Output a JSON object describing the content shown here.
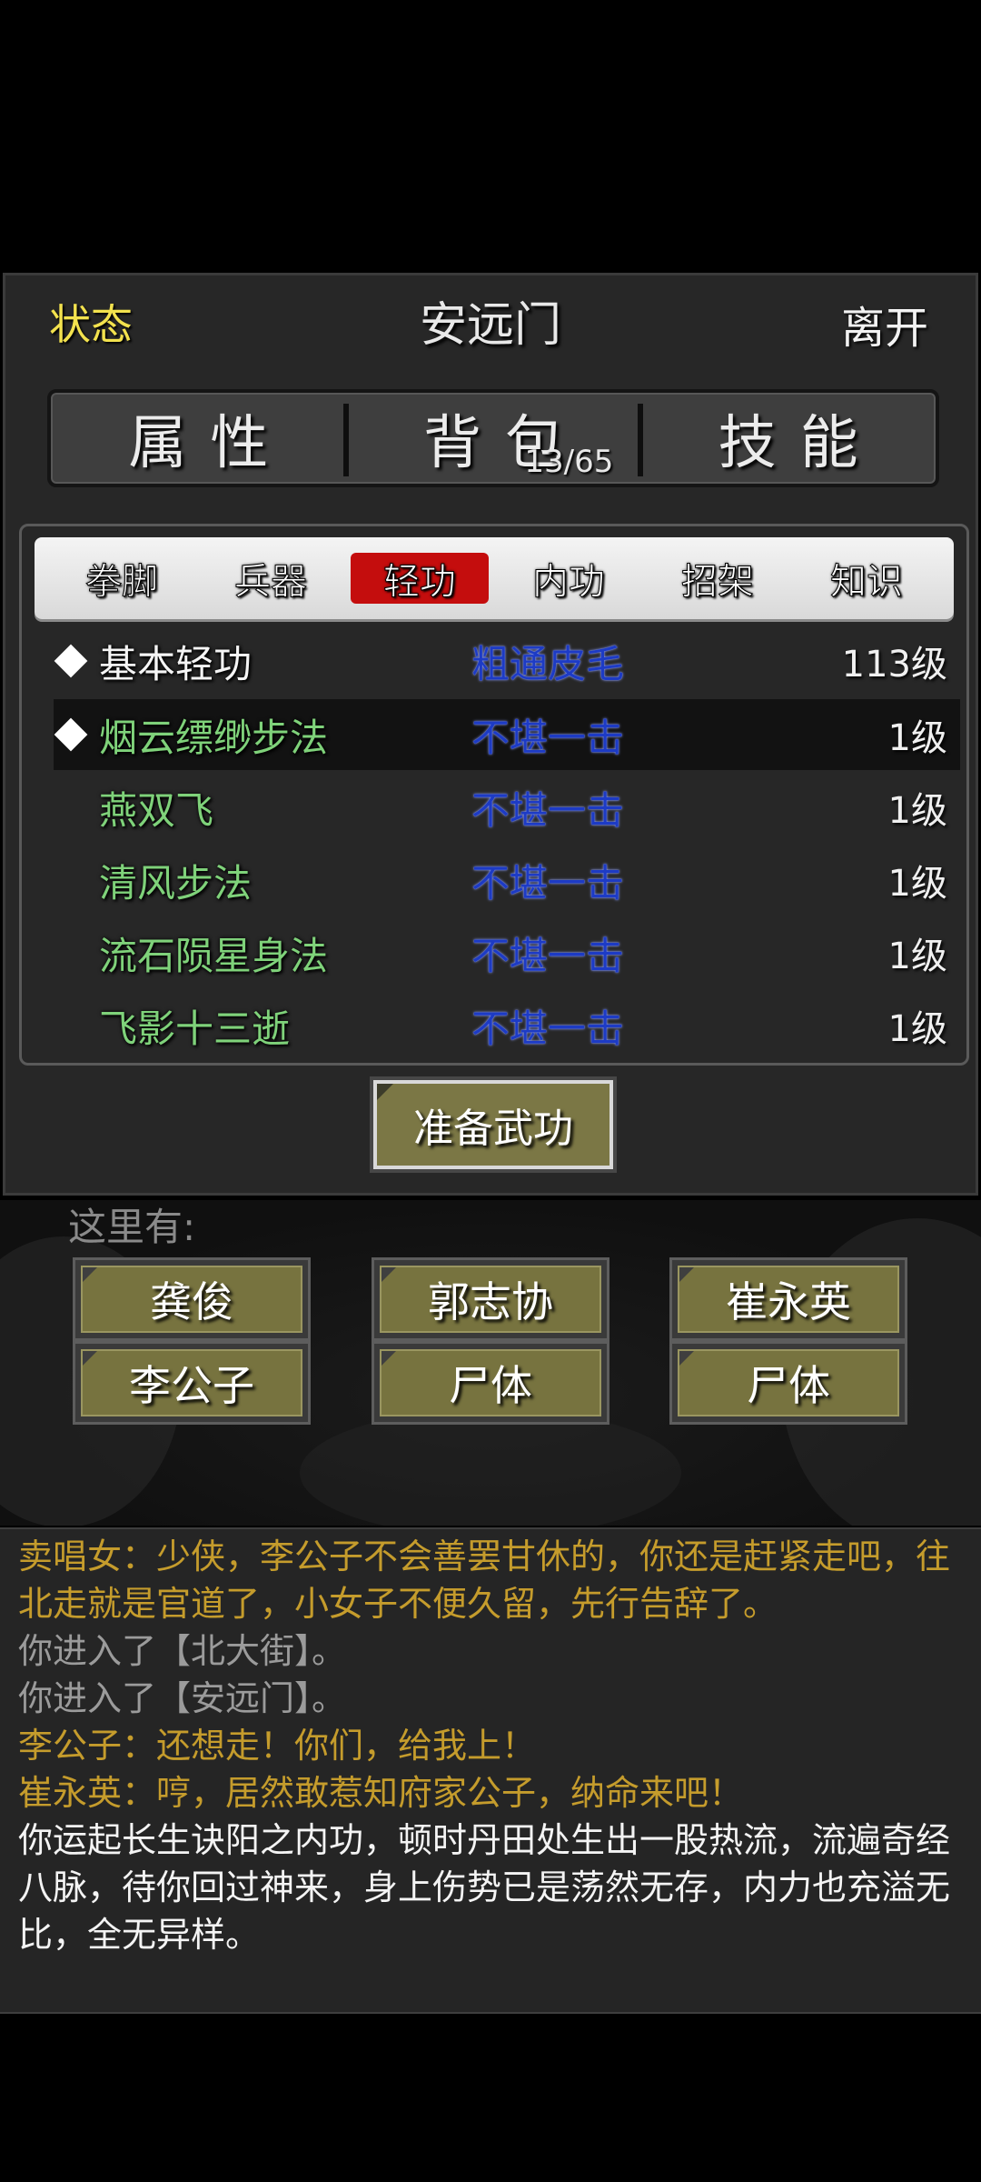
{
  "header": {
    "status": "状态",
    "title": "安远门",
    "leave": "离开"
  },
  "main_tabs": [
    {
      "label": "属性"
    },
    {
      "label": "背包",
      "sub": "13/65"
    },
    {
      "label": "技能"
    }
  ],
  "sub_tabs": [
    {
      "label": "拳脚",
      "active": false
    },
    {
      "label": "兵器",
      "active": false
    },
    {
      "label": "轻功",
      "active": true
    },
    {
      "label": "内功",
      "active": false
    },
    {
      "label": "招架",
      "active": false
    },
    {
      "label": "知识",
      "active": false
    }
  ],
  "skills": [
    {
      "name": "基本轻功",
      "level": "粗通皮毛",
      "grade": "113级",
      "marked": true,
      "selected": false,
      "name_color": "white"
    },
    {
      "name": "烟云缥缈步法",
      "level": "不堪一击",
      "grade": "1级",
      "marked": true,
      "selected": true,
      "name_color": "green"
    },
    {
      "name": "燕双飞",
      "level": "不堪一击",
      "grade": "1级",
      "marked": false,
      "selected": false,
      "name_color": "green"
    },
    {
      "name": "清风步法",
      "level": "不堪一击",
      "grade": "1级",
      "marked": false,
      "selected": false,
      "name_color": "green"
    },
    {
      "name": "流石陨星身法",
      "level": "不堪一击",
      "grade": "1级",
      "marked": false,
      "selected": false,
      "name_color": "green"
    },
    {
      "name": "飞影十三逝",
      "level": "不堪一击",
      "grade": "1级",
      "marked": false,
      "selected": false,
      "name_color": "green"
    }
  ],
  "prepare_button": "准备武功",
  "here": {
    "label": "这里有:",
    "npcs": [
      "龚俊",
      "郭志协",
      "崔永英",
      "李公子",
      "尸体",
      "尸体"
    ]
  },
  "log": [
    {
      "text": "卖唱女：少侠，李公子不会善罢甘休的，你还是赶紧走吧，往北走就是官道了，小女子不便久留，先行告辞了。",
      "color": "gold"
    },
    {
      "text": "你进入了【北大街】。",
      "color": "gray"
    },
    {
      "text": "你进入了【安远门】。",
      "color": "gray"
    },
    {
      "text": "李公子：还想走！你们，给我上！",
      "color": "gold"
    },
    {
      "text": "崔永英：哼，居然敢惹知府家公子，纳命来吧！",
      "color": "gold"
    },
    {
      "text": "你运起长生诀阳之内功，顿时丹田处生出一股热流，流遍奇经八脉，待你回过神来，身上伤势已是荡然无存，内力也充溢无比，全无异样。",
      "color": "white"
    }
  ],
  "colors": {
    "status_yellow": "#f3e24e",
    "active_tab_red": "#c40d0d",
    "skill_level_blue": "#1d3bc5",
    "skill_name_green": "#7fd27a",
    "button_olive": "#77733f",
    "log_gold": "#c59c2c"
  }
}
